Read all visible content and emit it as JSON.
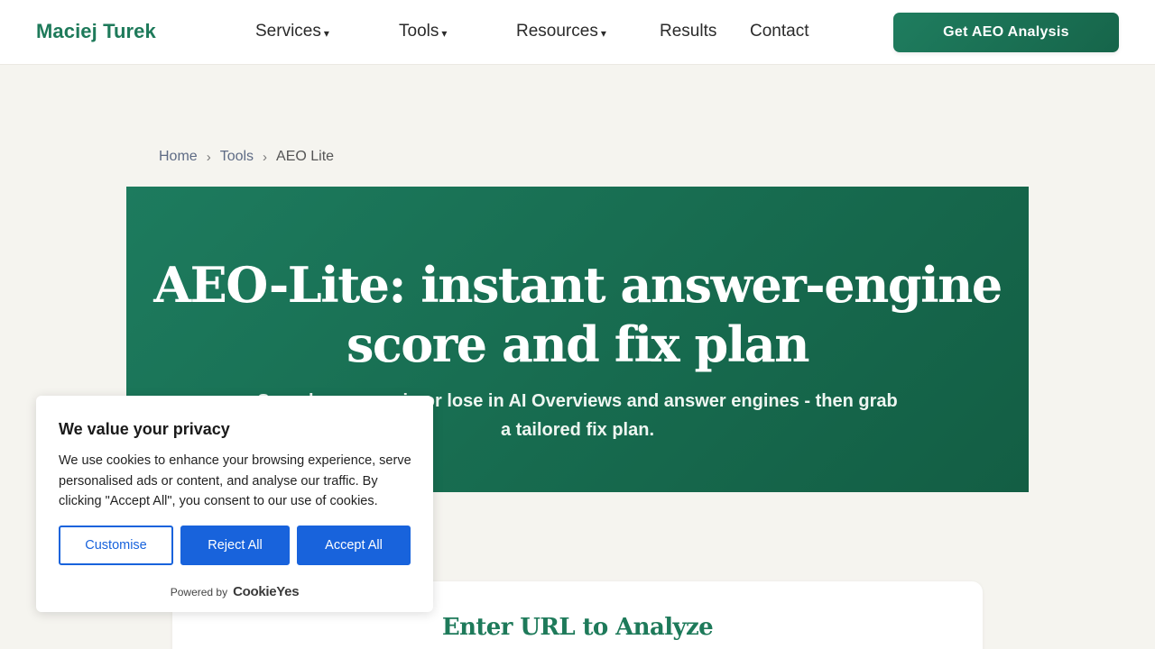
{
  "header": {
    "logo": "Maciej Turek",
    "nav": [
      {
        "label": "Services",
        "has_dropdown": true
      },
      {
        "label": "Tools",
        "has_dropdown": true
      },
      {
        "label": "Resources",
        "has_dropdown": true
      },
      {
        "label": "Results",
        "has_dropdown": false
      },
      {
        "label": "Contact",
        "has_dropdown": false
      }
    ],
    "caret": "▾",
    "cta_label": "Get AEO Analysis"
  },
  "breadcrumb": {
    "items": [
      "Home",
      "Tools",
      "AEO Lite"
    ],
    "separator": "›"
  },
  "hero": {
    "title": "AEO-Lite: instant answer-engine score and fix plan",
    "subtitle": "See where you win or lose in AI Overviews and answer engines - then grab a tailored fix plan."
  },
  "analyze_card": {
    "title": "Enter URL to Analyze"
  },
  "cookie_banner": {
    "title": "We value your privacy",
    "text": "We use cookies to enhance your browsing experience, serve personalised ads or content, and analyse our traffic. By clicking \"Accept All\", you consent to our use of cookies.",
    "buttons": {
      "customise": "Customise",
      "reject": "Reject All",
      "accept": "Accept All"
    },
    "powered_by": "Powered by",
    "brand": "CookieYes"
  },
  "colors": {
    "brand_green": "#1e7a5a",
    "hero_green": "#176b4f",
    "cookie_blue": "#1863dc",
    "page_bg": "#f5f4ef"
  }
}
